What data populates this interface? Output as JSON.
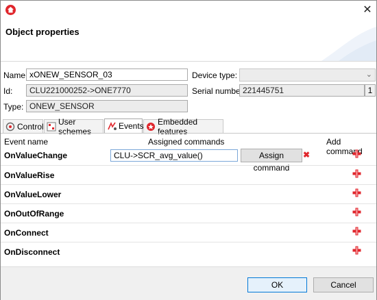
{
  "window": {
    "title": "",
    "close_symbol": "✕"
  },
  "header": {
    "title": "Object properties"
  },
  "form": {
    "name_label": "Name:",
    "name_value": "xONEW_SENSOR_03",
    "id_label": "Id:",
    "id_value": "CLU221000252->ONE7770",
    "type_label": "Type:",
    "type_value": "ONEW_SENSOR",
    "device_type_label": "Device type:",
    "device_type_value": "",
    "serial_label": "Serial number:",
    "serial_value": "221445751",
    "serial_count": "1"
  },
  "tabs": [
    {
      "label": "Control",
      "icon": "control-icon",
      "active": false
    },
    {
      "label": "User schemes",
      "icon": "user-schemes-icon",
      "active": false
    },
    {
      "label": "Events",
      "icon": "events-icon",
      "active": true
    },
    {
      "label": "Embedded features",
      "icon": "embedded-features-icon",
      "active": false
    }
  ],
  "events_table": {
    "col_event": "Event name",
    "col_assigned": "Assigned commands",
    "col_add": "Add command",
    "rows": [
      {
        "name": "OnValueChange",
        "command": "CLU->SCR_avg_value()",
        "assign_label": "Assign command",
        "delete_symbol": "✖"
      },
      {
        "name": "OnValueRise"
      },
      {
        "name": "OnValueLower"
      },
      {
        "name": "OnOutOfRange"
      },
      {
        "name": "OnConnect"
      },
      {
        "name": "OnDisconnect"
      }
    ]
  },
  "footer": {
    "ok_label": "OK",
    "cancel_label": "Cancel"
  },
  "colors": {
    "accent": "#e0262c",
    "focus": "#0078d7"
  }
}
